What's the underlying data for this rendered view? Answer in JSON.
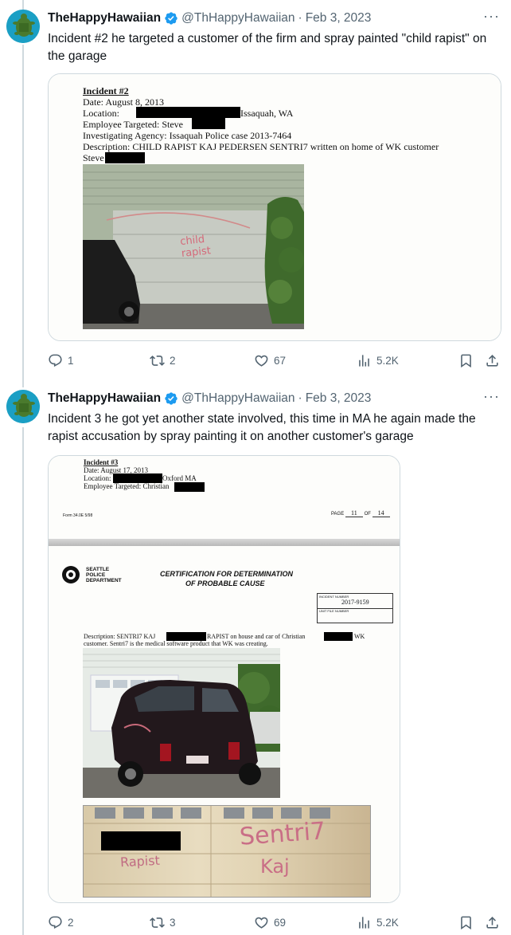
{
  "tweets": [
    {
      "author": {
        "name": "TheHappyHawaiian",
        "handle": "@ThHappyHawaiian",
        "date": "Feb 3, 2023"
      },
      "text": "Incident #2 he targeted a customer of the firm and spray painted \"child rapist\" on the garage",
      "document": {
        "title": "Incident #2",
        "lines": [
          "Date: August 8, 2013",
          "Location:",
          "Issaquah, WA",
          "Employee Targeted: Steve",
          "Investigating Agency: Issaquah Police case 2013-7464",
          "Description: CHILD RAPIST KAJ PEDERSEN SENTRI7 written on home of WK customer",
          "Steve"
        ],
        "graffiti": "child rapist"
      },
      "actions": {
        "replies": "1",
        "retweets": "2",
        "likes": "67",
        "views": "5.2K"
      }
    },
    {
      "author": {
        "name": "TheHappyHawaiian",
        "handle": "@ThHappyHawaiian",
        "date": "Feb 3, 2023"
      },
      "text": "Incident 3 he got yet another state involved, this time in MA he again made the rapist accusation by spray painting it on another customer's garage",
      "document": {
        "title": "Incident #3",
        "lines": [
          "Date: August 17, 2013",
          "Location:",
          "Oxford MA",
          "Employee Targeted: Christian"
        ],
        "form_no": "Form 34.0E  5/98",
        "page_label": "PAGE",
        "page_num": "11",
        "page_of": "OF",
        "page_total": "14",
        "dept": [
          "SEATTLE",
          "POLICE",
          "DEPARTMENT"
        ],
        "cert_title_1": "CERTIFICATION FOR DETERMINATION",
        "cert_title_2": "OF PROBABLE CAUSE",
        "incident_label": "INCIDENT NUMBER",
        "incident_number": "2017-9159",
        "unit_label": "UNIT FILE NUMBER",
        "desc_1a": "Description: SENTRI7 KAJ",
        "desc_1b": "RAPIST on house and car of Christian",
        "desc_1c": "WK",
        "desc_2": "customer. Sentri7 is the medical software product that WK was creating.",
        "graffiti_left": "Rapist",
        "graffiti_right_1": "Sentri7",
        "graffiti_right_2": "Kaj"
      },
      "actions": {
        "replies": "2",
        "retweets": "3",
        "likes": "69",
        "views": "5.2K"
      }
    }
  ],
  "icons": [
    "reply-icon",
    "retweet-icon",
    "like-icon",
    "views-icon",
    "bookmark-icon",
    "share-icon",
    "verified-icon",
    "more-icon"
  ],
  "colors": {
    "text": "#0f1419",
    "secondary": "#536471",
    "border": "#cfd9de",
    "verified": "#1d9bf0"
  }
}
